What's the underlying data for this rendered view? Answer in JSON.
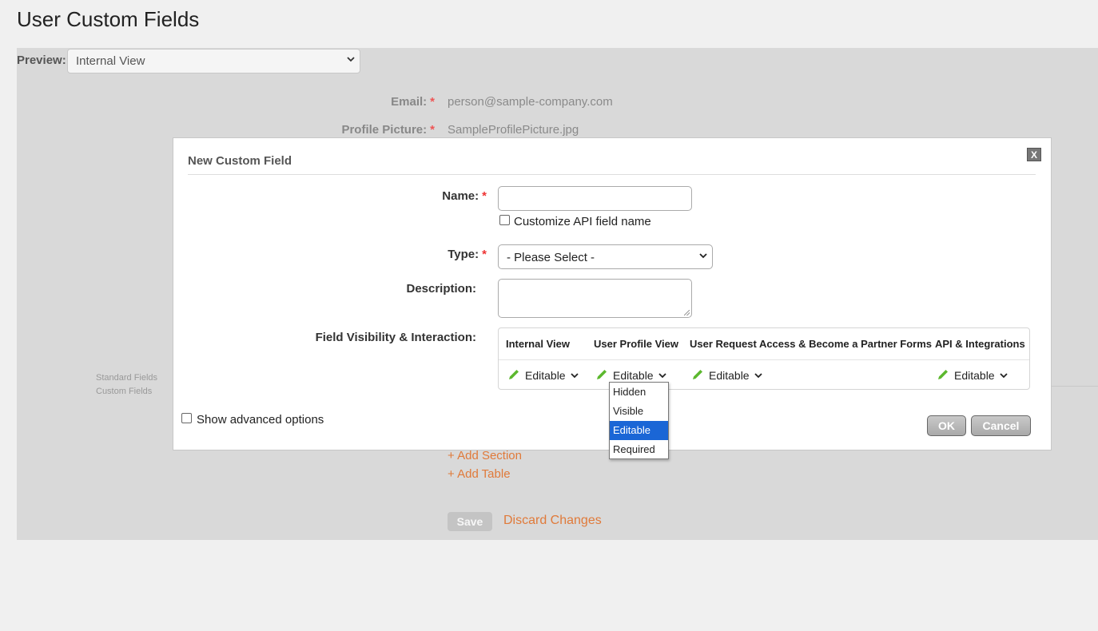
{
  "page": {
    "title": "User Custom Fields",
    "preview_label": "Preview:",
    "preview_value": "Internal View"
  },
  "background_form": {
    "email_label": "Email:",
    "email_value": "person@sample-company.com",
    "profile_picture_label": "Profile Picture:",
    "profile_picture_value": "SampleProfilePicture.jpg",
    "side_links": [
      "Standard Fields",
      "Custom Fields"
    ],
    "add_section": "+ Add Section",
    "add_table": "+ Add Table",
    "save_label": "Save",
    "discard_label": "Discard Changes"
  },
  "modal": {
    "title": "New Custom Field",
    "close_label": "X",
    "name_label": "Name:",
    "name_value": "",
    "customize_api_label": "Customize API field name",
    "type_label": "Type:",
    "type_value": "- Please Select -",
    "description_label": "Description:",
    "visibility_label": "Field Visibility & Interaction:",
    "visibility_columns": [
      {
        "header": "Internal View",
        "value": "Editable"
      },
      {
        "header": "User Profile View",
        "value": "Editable"
      },
      {
        "header": "User Request Access & Become a Partner Forms",
        "value": "Editable"
      },
      {
        "header": "API & Integrations",
        "value": "Editable"
      }
    ],
    "advanced_label": "Show advanced options",
    "ok_label": "OK",
    "cancel_label": "Cancel"
  },
  "dropdown": {
    "options": [
      "Hidden",
      "Visible",
      "Editable",
      "Required"
    ],
    "selected": "Editable"
  },
  "colors": {
    "accent_link": "#e07a3a",
    "required_star": "#e33333",
    "pencil": "#5cb82e",
    "selection": "#1a66d6"
  },
  "icons": [
    "chevron-down-icon",
    "pencil-icon",
    "close-icon",
    "resize-grip-icon"
  ]
}
